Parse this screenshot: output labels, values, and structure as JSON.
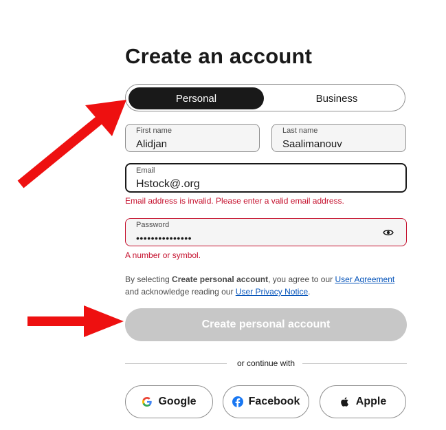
{
  "page": {
    "title": "Create an account"
  },
  "account_type": {
    "personal_label": "Personal",
    "business_label": "Business",
    "selected": "Personal"
  },
  "form": {
    "first_name": {
      "label": "First name",
      "value": "Alidjan"
    },
    "last_name": {
      "label": "Last name",
      "value": "Saalimanouv"
    },
    "email": {
      "label": "Email",
      "value": "Hstock@.org",
      "error": "Email address is invalid. Please enter a valid email address."
    },
    "password": {
      "label": "Password",
      "value": "•••••••••••••••",
      "error": "A number or symbol."
    }
  },
  "legal": {
    "prefix": "By selecting ",
    "bold": "Create personal account",
    "middle": ", you agree to our ",
    "link1": "User Agreement",
    "middle2": " and acknowledge reading our ",
    "link2": "User Privacy Notice",
    "suffix": "."
  },
  "submit": {
    "label": "Create personal account",
    "disabled": true
  },
  "divider": {
    "text": "or continue with"
  },
  "social": {
    "google": "Google",
    "facebook": "Facebook",
    "apple": "Apple"
  },
  "colors": {
    "error": "#c5112e",
    "link": "#0654ba",
    "dark": "#191919",
    "disabled_button": "#c7c7c7",
    "arrow": "#ee1010"
  },
  "annotations": {
    "arrows": [
      "arrow-pointing-to-personal-toggle",
      "arrow-pointing-to-create-button"
    ]
  }
}
